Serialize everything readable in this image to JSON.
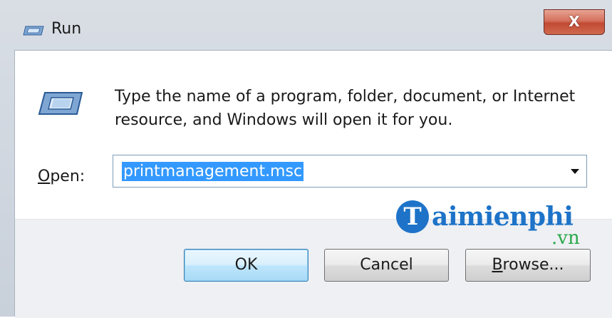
{
  "window": {
    "title": "Run",
    "close_label": "X"
  },
  "dialog": {
    "description": "Type the name of a program, folder, document, or Internet resource, and Windows will open it for you.",
    "open_label_accel": "O",
    "open_label_rest": "pen:",
    "open_value": "printmanagement.msc",
    "buttons": {
      "ok": "OK",
      "cancel": "Cancel",
      "browse_accel": "B",
      "browse_rest": "rowse..."
    }
  },
  "watermark": {
    "initial": "T",
    "name": "aimienphi",
    "suffix": ".vn"
  },
  "icons": {
    "title": "run-icon",
    "dialog": "run-icon",
    "dropdown": "chevron-down-icon"
  },
  "colors": {
    "selection": "#3399ff",
    "close_button": "#c24a33",
    "watermark_blue": "#1e73c8",
    "watermark_green": "#2aa84a"
  }
}
